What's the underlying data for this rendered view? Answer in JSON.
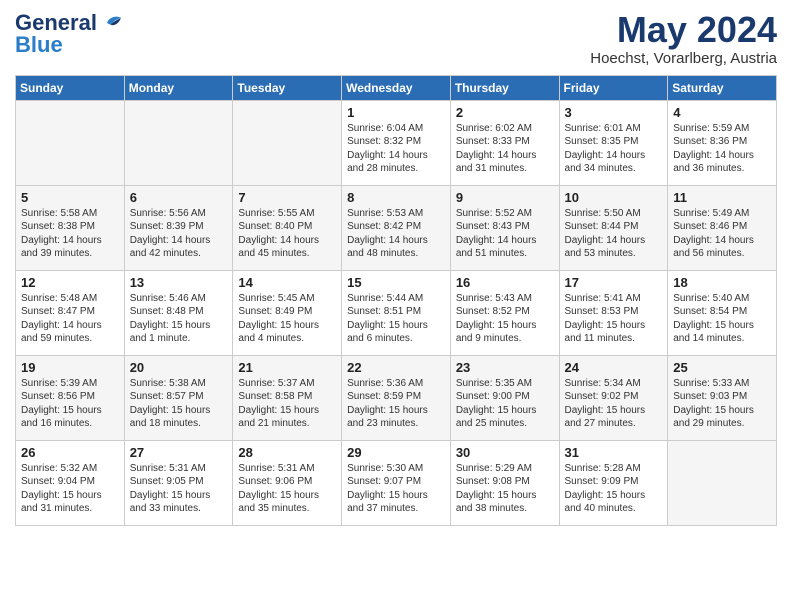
{
  "header": {
    "logo_line1": "General",
    "logo_line2": "Blue",
    "month": "May 2024",
    "location": "Hoechst, Vorarlberg, Austria"
  },
  "days_of_week": [
    "Sunday",
    "Monday",
    "Tuesday",
    "Wednesday",
    "Thursday",
    "Friday",
    "Saturday"
  ],
  "weeks": [
    [
      {
        "day": "",
        "info": ""
      },
      {
        "day": "",
        "info": ""
      },
      {
        "day": "",
        "info": ""
      },
      {
        "day": "1",
        "info": "Sunrise: 6:04 AM\nSunset: 8:32 PM\nDaylight: 14 hours\nand 28 minutes."
      },
      {
        "day": "2",
        "info": "Sunrise: 6:02 AM\nSunset: 8:33 PM\nDaylight: 14 hours\nand 31 minutes."
      },
      {
        "day": "3",
        "info": "Sunrise: 6:01 AM\nSunset: 8:35 PM\nDaylight: 14 hours\nand 34 minutes."
      },
      {
        "day": "4",
        "info": "Sunrise: 5:59 AM\nSunset: 8:36 PM\nDaylight: 14 hours\nand 36 minutes."
      }
    ],
    [
      {
        "day": "5",
        "info": "Sunrise: 5:58 AM\nSunset: 8:38 PM\nDaylight: 14 hours\nand 39 minutes."
      },
      {
        "day": "6",
        "info": "Sunrise: 5:56 AM\nSunset: 8:39 PM\nDaylight: 14 hours\nand 42 minutes."
      },
      {
        "day": "7",
        "info": "Sunrise: 5:55 AM\nSunset: 8:40 PM\nDaylight: 14 hours\nand 45 minutes."
      },
      {
        "day": "8",
        "info": "Sunrise: 5:53 AM\nSunset: 8:42 PM\nDaylight: 14 hours\nand 48 minutes."
      },
      {
        "day": "9",
        "info": "Sunrise: 5:52 AM\nSunset: 8:43 PM\nDaylight: 14 hours\nand 51 minutes."
      },
      {
        "day": "10",
        "info": "Sunrise: 5:50 AM\nSunset: 8:44 PM\nDaylight: 14 hours\nand 53 minutes."
      },
      {
        "day": "11",
        "info": "Sunrise: 5:49 AM\nSunset: 8:46 PM\nDaylight: 14 hours\nand 56 minutes."
      }
    ],
    [
      {
        "day": "12",
        "info": "Sunrise: 5:48 AM\nSunset: 8:47 PM\nDaylight: 14 hours\nand 59 minutes."
      },
      {
        "day": "13",
        "info": "Sunrise: 5:46 AM\nSunset: 8:48 PM\nDaylight: 15 hours\nand 1 minute."
      },
      {
        "day": "14",
        "info": "Sunrise: 5:45 AM\nSunset: 8:49 PM\nDaylight: 15 hours\nand 4 minutes."
      },
      {
        "day": "15",
        "info": "Sunrise: 5:44 AM\nSunset: 8:51 PM\nDaylight: 15 hours\nand 6 minutes."
      },
      {
        "day": "16",
        "info": "Sunrise: 5:43 AM\nSunset: 8:52 PM\nDaylight: 15 hours\nand 9 minutes."
      },
      {
        "day": "17",
        "info": "Sunrise: 5:41 AM\nSunset: 8:53 PM\nDaylight: 15 hours\nand 11 minutes."
      },
      {
        "day": "18",
        "info": "Sunrise: 5:40 AM\nSunset: 8:54 PM\nDaylight: 15 hours\nand 14 minutes."
      }
    ],
    [
      {
        "day": "19",
        "info": "Sunrise: 5:39 AM\nSunset: 8:56 PM\nDaylight: 15 hours\nand 16 minutes."
      },
      {
        "day": "20",
        "info": "Sunrise: 5:38 AM\nSunset: 8:57 PM\nDaylight: 15 hours\nand 18 minutes."
      },
      {
        "day": "21",
        "info": "Sunrise: 5:37 AM\nSunset: 8:58 PM\nDaylight: 15 hours\nand 21 minutes."
      },
      {
        "day": "22",
        "info": "Sunrise: 5:36 AM\nSunset: 8:59 PM\nDaylight: 15 hours\nand 23 minutes."
      },
      {
        "day": "23",
        "info": "Sunrise: 5:35 AM\nSunset: 9:00 PM\nDaylight: 15 hours\nand 25 minutes."
      },
      {
        "day": "24",
        "info": "Sunrise: 5:34 AM\nSunset: 9:02 PM\nDaylight: 15 hours\nand 27 minutes."
      },
      {
        "day": "25",
        "info": "Sunrise: 5:33 AM\nSunset: 9:03 PM\nDaylight: 15 hours\nand 29 minutes."
      }
    ],
    [
      {
        "day": "26",
        "info": "Sunrise: 5:32 AM\nSunset: 9:04 PM\nDaylight: 15 hours\nand 31 minutes."
      },
      {
        "day": "27",
        "info": "Sunrise: 5:31 AM\nSunset: 9:05 PM\nDaylight: 15 hours\nand 33 minutes."
      },
      {
        "day": "28",
        "info": "Sunrise: 5:31 AM\nSunset: 9:06 PM\nDaylight: 15 hours\nand 35 minutes."
      },
      {
        "day": "29",
        "info": "Sunrise: 5:30 AM\nSunset: 9:07 PM\nDaylight: 15 hours\nand 37 minutes."
      },
      {
        "day": "30",
        "info": "Sunrise: 5:29 AM\nSunset: 9:08 PM\nDaylight: 15 hours\nand 38 minutes."
      },
      {
        "day": "31",
        "info": "Sunrise: 5:28 AM\nSunset: 9:09 PM\nDaylight: 15 hours\nand 40 minutes."
      },
      {
        "day": "",
        "info": ""
      }
    ]
  ]
}
